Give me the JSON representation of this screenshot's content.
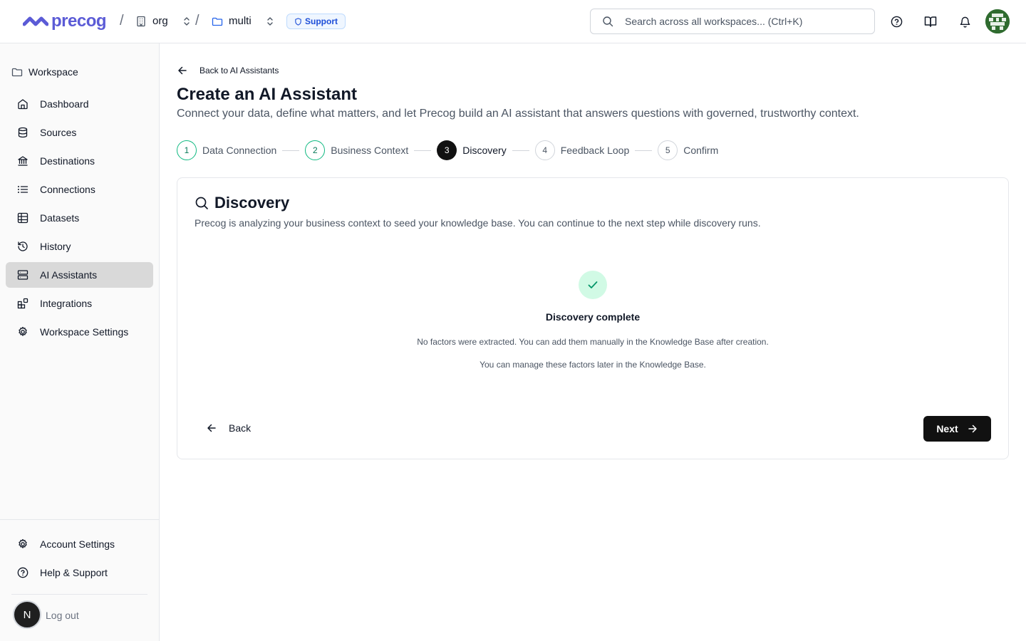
{
  "header": {
    "logo_text": "precog",
    "breadcrumb_sep": "/",
    "org_label": "org",
    "workspace_label": "multi",
    "support_label": "Support",
    "search_placeholder": "Search across all workspaces... (Ctrl+K)",
    "icons": [
      "help-circle-icon",
      "book-open-icon",
      "bell-icon",
      "user-avatar"
    ],
    "brand_color": "#5b5bd6"
  },
  "sidebar": {
    "workspace_title": "Workspace",
    "items": [
      {
        "label": "Dashboard",
        "icon": "home-icon"
      },
      {
        "label": "Sources",
        "icon": "database-icon"
      },
      {
        "label": "Destinations",
        "icon": "landmark-icon"
      },
      {
        "label": "Connections",
        "icon": "list-icon"
      },
      {
        "label": "Datasets",
        "icon": "table-icon"
      },
      {
        "label": "History",
        "icon": "history-icon"
      },
      {
        "label": "AI Assistants",
        "icon": "server-icon",
        "active": true
      },
      {
        "label": "Integrations",
        "icon": "blocks-icon"
      },
      {
        "label": "Workspace Settings",
        "icon": "settings-icon"
      }
    ],
    "bottom": {
      "account_settings": "Account Settings",
      "help_support": "Help & Support",
      "user_initial": "N",
      "logout": "Log out"
    }
  },
  "main": {
    "back_link": "Back to AI Assistants",
    "title": "Create an AI Assistant",
    "subtitle": "Connect your data, define what matters, and let Precog build an AI assistant that answers questions with governed, trustworthy context.",
    "steps": [
      {
        "number": "1",
        "label": "Data Connection",
        "state": "done"
      },
      {
        "number": "2",
        "label": "Business Context",
        "state": "done"
      },
      {
        "number": "3",
        "label": "Discovery",
        "state": "current"
      },
      {
        "number": "4",
        "label": "Feedback Loop",
        "state": "todo"
      },
      {
        "number": "5",
        "label": "Confirm",
        "state": "todo"
      }
    ],
    "card": {
      "title": "Discovery",
      "subtitle": "Precog is analyzing your business context to seed your knowledge base. You can continue to the next step while discovery runs.",
      "status_title": "Discovery complete",
      "status_line_1": "No factors were extracted. You can add them manually in the Knowledge Base after creation.",
      "status_line_2": "You can manage these factors later in the Knowledge Base.",
      "back_label": "Back",
      "next_label": "Next"
    },
    "colors": {
      "success": "#10b981",
      "success_bg": "#d1fae5",
      "primary_button": "#111111"
    }
  }
}
